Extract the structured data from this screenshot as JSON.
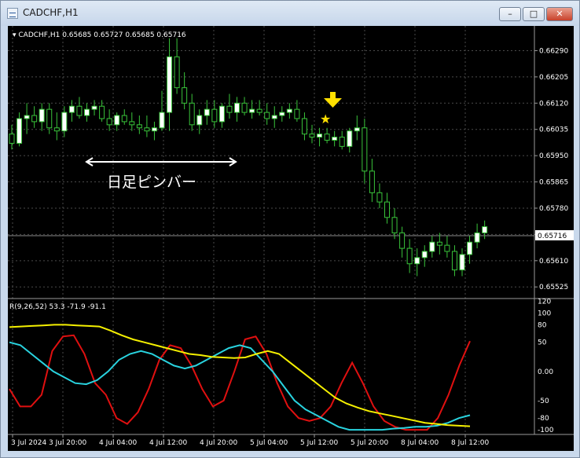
{
  "window": {
    "title": "CADCHF,H1",
    "minimize": "–",
    "maximize": "□",
    "close": "✕"
  },
  "main_panel": {
    "header": "▾ CADCHF,H1  0.65685 0.65727 0.65685 0.65716",
    "current_price": "0.65716",
    "annotation": "日足ピンバー",
    "price_labels": [
      "0.66290",
      "0.66205",
      "0.66120",
      "0.66035",
      "0.65950",
      "0.65865",
      "0.65780",
      "0.65695",
      "0.65610",
      "0.65525"
    ]
  },
  "sub_panel": {
    "header": "R(9,26,52) 53.3 -71.9 -91.1",
    "axis_labels": [
      "120",
      "100",
      "80",
      "50",
      "0.00",
      "-50",
      "-80",
      "-100"
    ]
  },
  "time_labels": [
    "3 Jul 2024",
    "3 Jul 20:00",
    "4 Jul 04:00",
    "4 Jul 12:00",
    "4 Jul 20:00",
    "5 Jul 04:00",
    "5 Jul 12:00",
    "5 Jul 20:00",
    "8 Jul 04:00",
    "8 Jul 12:00"
  ],
  "colors": {
    "background": "#000000",
    "bull_candle": "#ffffff",
    "bear_candle": "#000000",
    "wick": "#39c43a",
    "grid": "#4a4a4a",
    "text": "#ffffff",
    "line_red": "#e01010",
    "line_yellow": "#f5f000",
    "line_cyan": "#29d3df",
    "arrow": "#ffe000",
    "star": "#ffe000"
  },
  "chart_data": {
    "type": "candlestick",
    "symbol": "CADCHF",
    "timeframe": "H1",
    "ylim": [
      0.6549,
      0.6637
    ],
    "last_price": 0.65716,
    "candles": [
      [
        0.6602,
        0.6605,
        0.6597,
        0.6599
      ],
      [
        0.6599,
        0.6609,
        0.6598,
        0.6607
      ],
      [
        0.6607,
        0.6612,
        0.6602,
        0.6608
      ],
      [
        0.6608,
        0.6611,
        0.6604,
        0.6606
      ],
      [
        0.6606,
        0.6612,
        0.6603,
        0.661
      ],
      [
        0.661,
        0.6612,
        0.6602,
        0.6604
      ],
      [
        0.6604,
        0.6609,
        0.66,
        0.6603
      ],
      [
        0.6603,
        0.6611,
        0.6601,
        0.6609
      ],
      [
        0.6609,
        0.6613,
        0.6606,
        0.6611
      ],
      [
        0.6611,
        0.6614,
        0.6607,
        0.6608
      ],
      [
        0.6608,
        0.6612,
        0.6606,
        0.661
      ],
      [
        0.661,
        0.6613,
        0.6608,
        0.6611
      ],
      [
        0.6611,
        0.6613,
        0.6606,
        0.6607
      ],
      [
        0.6607,
        0.661,
        0.6603,
        0.6605
      ],
      [
        0.6605,
        0.6609,
        0.6603,
        0.6608
      ],
      [
        0.6608,
        0.661,
        0.6605,
        0.6606
      ],
      [
        0.6606,
        0.6609,
        0.6603,
        0.6605
      ],
      [
        0.6605,
        0.6608,
        0.6602,
        0.6604
      ],
      [
        0.6604,
        0.6608,
        0.6601,
        0.6603
      ],
      [
        0.6603,
        0.6606,
        0.66,
        0.6604
      ],
      [
        0.6604,
        0.6616,
        0.6603,
        0.6609
      ],
      [
        0.6609,
        0.6633,
        0.6603,
        0.6627
      ],
      [
        0.6627,
        0.6633,
        0.6615,
        0.6617
      ],
      [
        0.6617,
        0.6622,
        0.661,
        0.6612
      ],
      [
        0.6612,
        0.6615,
        0.6603,
        0.6605
      ],
      [
        0.6605,
        0.661,
        0.6602,
        0.6608
      ],
      [
        0.6608,
        0.6613,
        0.6605,
        0.661
      ],
      [
        0.661,
        0.6613,
        0.6604,
        0.6606
      ],
      [
        0.6606,
        0.6612,
        0.6604,
        0.6611
      ],
      [
        0.6611,
        0.6615,
        0.6607,
        0.6609
      ],
      [
        0.6609,
        0.6614,
        0.6606,
        0.6612
      ],
      [
        0.6612,
        0.6614,
        0.6608,
        0.6609
      ],
      [
        0.6609,
        0.6613,
        0.6607,
        0.661
      ],
      [
        0.661,
        0.6613,
        0.6608,
        0.6609
      ],
      [
        0.6609,
        0.6612,
        0.6605,
        0.6607
      ],
      [
        0.6607,
        0.6611,
        0.6604,
        0.6608
      ],
      [
        0.6608,
        0.6611,
        0.6606,
        0.6609
      ],
      [
        0.6609,
        0.6612,
        0.6607,
        0.661
      ],
      [
        0.661,
        0.6613,
        0.6606,
        0.6607
      ],
      [
        0.6607,
        0.6609,
        0.66,
        0.6602
      ],
      [
        0.6602,
        0.6605,
        0.6599,
        0.6601
      ],
      [
        0.6601,
        0.6604,
        0.6598,
        0.6602
      ],
      [
        0.6602,
        0.6604,
        0.6599,
        0.66
      ],
      [
        0.66,
        0.6603,
        0.6598,
        0.6601
      ],
      [
        0.6601,
        0.6603,
        0.6597,
        0.6598
      ],
      [
        0.6598,
        0.6604,
        0.6596,
        0.6603
      ],
      [
        0.6603,
        0.6608,
        0.66,
        0.6604
      ],
      [
        0.6604,
        0.6607,
        0.6586,
        0.659
      ],
      [
        0.659,
        0.6594,
        0.658,
        0.6583
      ],
      [
        0.6583,
        0.6586,
        0.6578,
        0.658
      ],
      [
        0.658,
        0.6583,
        0.6573,
        0.6575
      ],
      [
        0.6575,
        0.6578,
        0.6568,
        0.657
      ],
      [
        0.657,
        0.6572,
        0.6562,
        0.6565
      ],
      [
        0.6565,
        0.6568,
        0.6557,
        0.656
      ],
      [
        0.656,
        0.6565,
        0.6556,
        0.6562
      ],
      [
        0.6562,
        0.6566,
        0.6559,
        0.6564
      ],
      [
        0.6564,
        0.6569,
        0.6562,
        0.6567
      ],
      [
        0.6567,
        0.657,
        0.6563,
        0.6566
      ],
      [
        0.6566,
        0.6569,
        0.6562,
        0.6564
      ],
      [
        0.6564,
        0.6566,
        0.6556,
        0.6558
      ],
      [
        0.6558,
        0.6565,
        0.6556,
        0.6563
      ],
      [
        0.6563,
        0.6569,
        0.656,
        0.6567
      ],
      [
        0.6567,
        0.6573,
        0.6565,
        0.657
      ],
      [
        0.657,
        0.6574,
        0.6568,
        0.6572
      ]
    ],
    "oscillator": {
      "name": "R(9,26,52)",
      "ylim": [
        -108,
        125
      ],
      "series": [
        {
          "name": "9",
          "values": [
            -30,
            -60,
            -60,
            -40,
            35,
            60,
            62,
            30,
            -20,
            -40,
            -80,
            -90,
            -70,
            -30,
            20,
            45,
            40,
            10,
            -30,
            -60,
            -50,
            0,
            55,
            60,
            30,
            -20,
            -60,
            -80,
            -85,
            -80,
            -60,
            -20,
            15,
            -20,
            -60,
            -85,
            -95,
            -100,
            -100,
            -100,
            -80,
            -40,
            10,
            52
          ]
        },
        {
          "name": "26",
          "values": [
            50,
            45,
            30,
            15,
            0,
            -10,
            -20,
            -22,
            -15,
            0,
            20,
            30,
            35,
            30,
            20,
            10,
            5,
            10,
            20,
            30,
            40,
            45,
            40,
            20,
            0,
            -25,
            -50,
            -65,
            -75,
            -85,
            -95,
            -100,
            -100,
            -100,
            -100,
            -98,
            -97,
            -95,
            -95,
            -93,
            -88,
            -80,
            -75
          ]
        },
        {
          "name": "52",
          "values": [
            76,
            77,
            78,
            79,
            80,
            80,
            79,
            78,
            77,
            70,
            62,
            55,
            50,
            45,
            40,
            35,
            30,
            28,
            25,
            24,
            23,
            24,
            30,
            35,
            30,
            15,
            0,
            -15,
            -30,
            -45,
            -55,
            -62,
            -68,
            -72,
            -76,
            -80,
            -84,
            -88,
            -90,
            -92,
            -93,
            -94
          ]
        }
      ]
    }
  }
}
